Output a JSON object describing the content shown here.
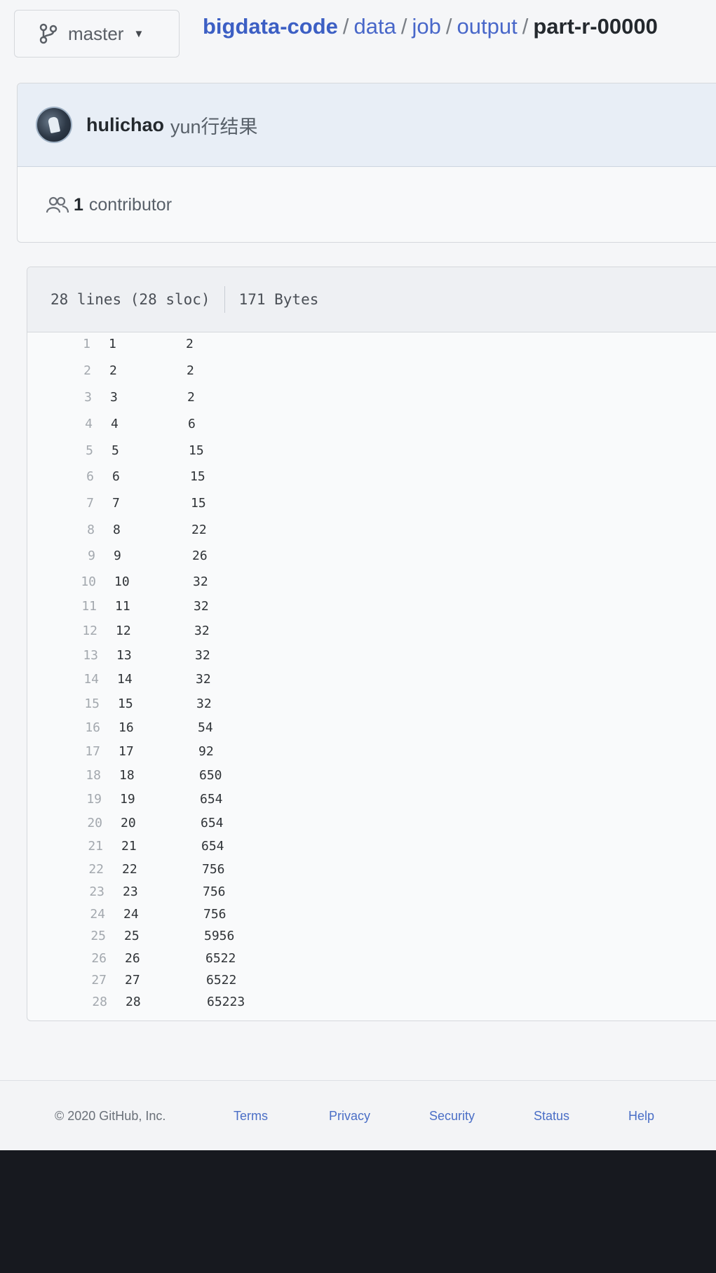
{
  "branch": {
    "label": "master",
    "icon": "git-branch-icon"
  },
  "breadcrumb": {
    "repo": "bigdata-code",
    "sep": "/",
    "path": [
      "data",
      "job",
      "output"
    ],
    "file": "part-r-00000"
  },
  "commit": {
    "author": "hulichao",
    "message": "yun行结果"
  },
  "contributors": {
    "count": "1",
    "label": "contributor"
  },
  "file": {
    "lines_info": "28 lines (28 sloc)",
    "size": "171 Bytes"
  },
  "lines": [
    {
      "n": "1",
      "a": "1",
      "b": "2"
    },
    {
      "n": "2",
      "a": "2",
      "b": "2"
    },
    {
      "n": "3",
      "a": "3",
      "b": "2"
    },
    {
      "n": "4",
      "a": "4",
      "b": "6"
    },
    {
      "n": "5",
      "a": "5",
      "b": "15"
    },
    {
      "n": "6",
      "a": "6",
      "b": "15"
    },
    {
      "n": "7",
      "a": "7",
      "b": "15"
    },
    {
      "n": "8",
      "a": "8",
      "b": "22"
    },
    {
      "n": "9",
      "a": "9",
      "b": "26"
    },
    {
      "n": "10",
      "a": "10",
      "b": "32"
    },
    {
      "n": "11",
      "a": "11",
      "b": "32"
    },
    {
      "n": "12",
      "a": "12",
      "b": "32"
    },
    {
      "n": "13",
      "a": "13",
      "b": "32"
    },
    {
      "n": "14",
      "a": "14",
      "b": "32"
    },
    {
      "n": "15",
      "a": "15",
      "b": "32"
    },
    {
      "n": "16",
      "a": "16",
      "b": "54"
    },
    {
      "n": "17",
      "a": "17",
      "b": "92"
    },
    {
      "n": "18",
      "a": "18",
      "b": "650"
    },
    {
      "n": "19",
      "a": "19",
      "b": "654"
    },
    {
      "n": "20",
      "a": "20",
      "b": "654"
    },
    {
      "n": "21",
      "a": "21",
      "b": "654"
    },
    {
      "n": "22",
      "a": "22",
      "b": "756"
    },
    {
      "n": "23",
      "a": "23",
      "b": "756"
    },
    {
      "n": "24",
      "a": "24",
      "b": "756"
    },
    {
      "n": "25",
      "a": "25",
      "b": "5956"
    },
    {
      "n": "26",
      "a": "26",
      "b": "6522"
    },
    {
      "n": "27",
      "a": "27",
      "b": "6522"
    },
    {
      "n": "28",
      "a": "28",
      "b": "65223"
    }
  ],
  "footer": {
    "copyright": "© 2020 GitHub, Inc.",
    "links": [
      "Terms",
      "Privacy",
      "Security",
      "Status",
      "Help"
    ]
  },
  "colors": {
    "link": "#4867c9",
    "commit_header_bg": "#e8eef6"
  }
}
